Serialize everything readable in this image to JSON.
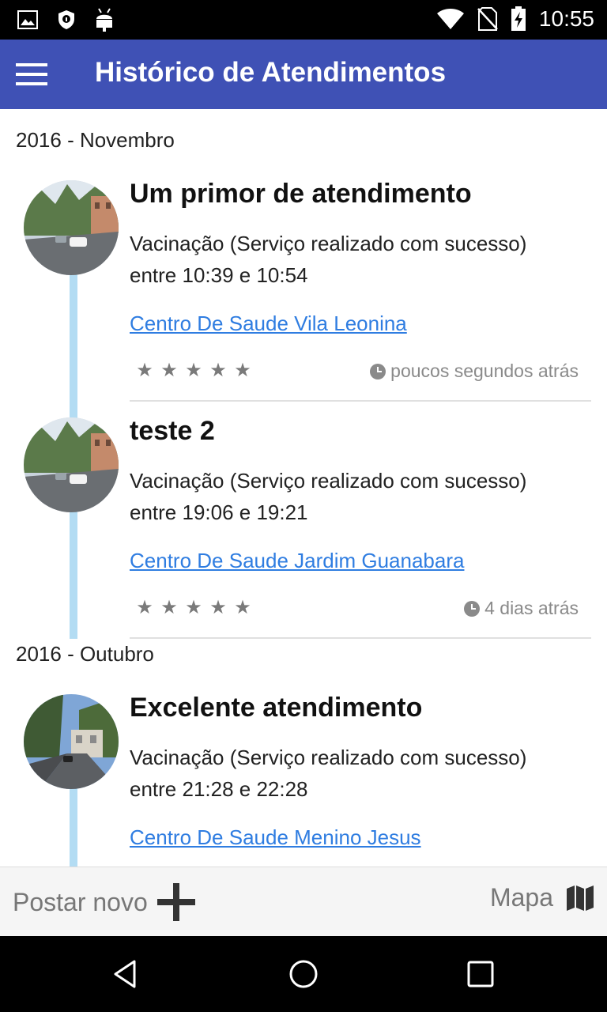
{
  "status_bar": {
    "time": "10:55",
    "left_icons": [
      "image-icon",
      "shield-icon",
      "android-icon"
    ],
    "right_icons": [
      "wifi-icon",
      "no-sim-icon",
      "battery-charging-icon"
    ]
  },
  "app_bar": {
    "title": "Histórico de Atendimentos",
    "menu_icon": "hamburger-menu-icon",
    "background": "#3f51b5"
  },
  "groups": [
    {
      "month": "2016 - Novembro",
      "items": [
        {
          "title": "Um primor de atendimento",
          "service": "Vacinação (Serviço realizado com sucesso)",
          "time_range": "entre 10:39 e 10:54",
          "place": "Centro De Saude Vila Leonina",
          "stars": [
            "★",
            "★",
            "★",
            "★",
            "★"
          ],
          "time_ago": "poucos segundos atrás"
        },
        {
          "title": "teste 2",
          "service": "Vacinação (Serviço realizado com sucesso)",
          "time_range": "entre 19:06 e 19:21",
          "place": "Centro De Saude Jardim Guanabara",
          "stars": [
            "★",
            "★",
            "★",
            "★",
            "★"
          ],
          "time_ago": "4 dias atrás"
        }
      ]
    },
    {
      "month": "2016 - Outubro",
      "items": [
        {
          "title": "Excelente atendimento",
          "service": "Vacinação (Serviço realizado com sucesso)",
          "time_range": "entre 21:28 e 22:28",
          "place": "Centro De Saude Menino Jesus"
        }
      ]
    }
  ],
  "action_bar": {
    "post_new_label": "Postar novo",
    "post_new_icon": "plus-icon",
    "map_label": "Mapa",
    "map_icon": "map-icon"
  },
  "nav_bar": {
    "icons": [
      "back-icon",
      "home-icon",
      "recents-icon"
    ]
  },
  "colors": {
    "accent": "#3f51b5",
    "link": "#2f7de1",
    "timeline": "#b3dcf3"
  }
}
